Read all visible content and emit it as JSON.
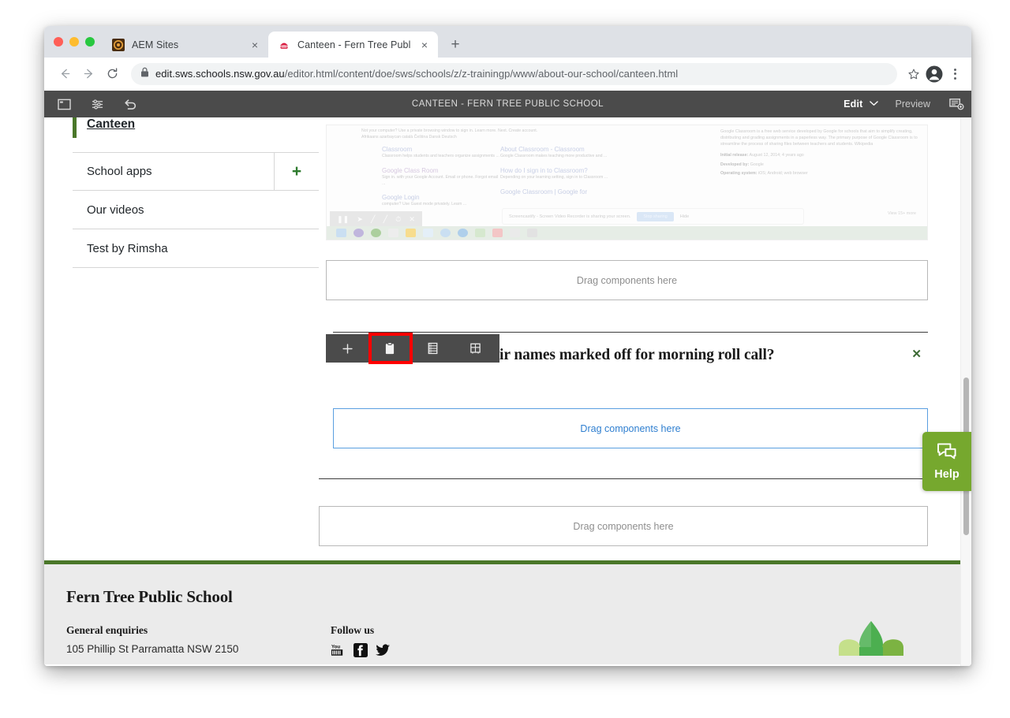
{
  "browser": {
    "tabs": [
      {
        "title": "AEM Sites",
        "favicon": "aem-icon",
        "active": false
      },
      {
        "title": "Canteen - Fern Tree Public Sch",
        "favicon": "nsw-waratah-icon",
        "active": true
      }
    ],
    "new_tab_label": "+",
    "close_label": "×",
    "url_secure_host": "edit.sws.schools.nsw.gov.au",
    "url_path": "/editor.html/content/doe/sws/schools/z/z-trainingp/www/about-our-school/canteen.html",
    "icons": {
      "back": "back-arrow-icon",
      "forward": "forward-arrow-icon",
      "reload": "reload-icon",
      "lock": "lock-icon",
      "bookmark": "star-icon",
      "profile": "profile-avatar-icon",
      "menu": "kebab-menu-icon"
    }
  },
  "aem_toolbar": {
    "page_title": "CANTEEN - FERN TREE PUBLIC SCHOOL",
    "sidebar_toggle": "sidebar-panel-icon",
    "page_properties": "page-properties-icon",
    "undo": "undo-icon",
    "mode_label": "Edit",
    "mode_caret": "⌄",
    "preview_label": "Preview",
    "annotations": "annotations-icon"
  },
  "sidenav": {
    "items": [
      {
        "label": "Canteen",
        "current": true,
        "has_plus": false
      },
      {
        "label": "School apps",
        "current": false,
        "has_plus": true,
        "plus_label": "+"
      },
      {
        "label": "Our videos",
        "current": false,
        "has_plus": false
      },
      {
        "label": "Test by Rimsha",
        "current": false,
        "has_plus": false
      }
    ]
  },
  "embedded_screenshot": {
    "alt": "google-classroom-search-results-screen-recording",
    "left_column": [
      {
        "link": "Classroom",
        "sub": "Classroom helps students and teachers organize assignments ..."
      },
      {
        "link": "Google Class Room",
        "sub": "Sign in. with your Google Account. Email or phone. Forgot email ..."
      },
      {
        "link": "Google Login",
        "sub": "computer? Use Guest mode privately. Learn ..."
      }
    ],
    "right_column": [
      {
        "link": "About Classroom - Classroom",
        "sub": "Google Classroom makes teaching more productive and ..."
      },
      {
        "link": "How do I sign in to Classroom?",
        "sub": "Depending on your learning setting, sign in to Classroom ..."
      },
      {
        "link": "Google Classroom | Google for",
        "sub": ""
      }
    ],
    "top_note": "Not your computer? Use a private browsing window to sign in. Learn more. Next. Create account.",
    "languages": "Afrikaans   azarbaycan   català   Čeština   Dansk   Deutsch",
    "knowledge_panel": {
      "description": "Google Classroom is a free web service developed by Google for schools that aim to simplify creating, distributing and grading assignments in a paperless way. The primary purpose of Google Classroom is to streamline the process of sharing files between teachers and students. Wikipedia",
      "facts": [
        {
          "label": "Initial release:",
          "value": "August 12, 2014; 4 years ago"
        },
        {
          "label": "Developed by:",
          "value": "Google"
        },
        {
          "label": "Operating system:",
          "value": "iOS; Android; web browser"
        }
      ]
    },
    "share_bar": {
      "message": "Screencastify - Screen Video Recorder is sharing your screen.",
      "stop_label": "Stop sharing",
      "hide_label": "Hide"
    },
    "recorder_tools": [
      "pause-icon",
      "cursor-icon",
      "pen-icon",
      "highlighter-icon",
      "timer-icon",
      "close-icon"
    ],
    "more_label": "View 15+ more",
    "for_label": "for"
  },
  "editor": {
    "dropzone_label": "Drag components here",
    "dropzones": [
      {
        "label": "Drag components here",
        "active": false
      },
      {
        "label": "Drag components here",
        "active": true
      },
      {
        "label": "Drag components here",
        "active": false
      }
    ],
    "question_heading": "How do students have their names marked off for morning roll call?",
    "question_close": "✕",
    "component_toolbar": {
      "buttons": [
        {
          "name": "insert-component-button",
          "icon": "plus-icon",
          "glyph": "+",
          "highlighted": false
        },
        {
          "name": "paste-component-button",
          "icon": "clipboard-paste-icon",
          "glyph": "clipboard",
          "highlighted": true
        },
        {
          "name": "group-component-button",
          "icon": "group-layers-icon",
          "glyph": "layers",
          "highlighted": false
        },
        {
          "name": "layout-component-button",
          "icon": "layout-container-icon",
          "glyph": "layout",
          "highlighted": false
        }
      ]
    }
  },
  "help_widget": {
    "label": "Help",
    "icon": "chat-bubbles-icon",
    "color": "#76a82e"
  },
  "footer": {
    "school_name": "Fern Tree Public School",
    "enquiries_heading": "General enquiries",
    "address": "105 Phillip St Parramatta NSW 2150",
    "follow_heading": "Follow us",
    "social": [
      "youtube-icon",
      "facebook-icon",
      "twitter-icon"
    ],
    "logo": "fern-tree-leaf-logo"
  },
  "theme": {
    "accent_green": "#4a7729",
    "help_green": "#76a82e",
    "toolbar_grey": "#4b4b4b",
    "highlight_red": "#ff0000",
    "dropzone_blue": "#2f7fd0"
  }
}
